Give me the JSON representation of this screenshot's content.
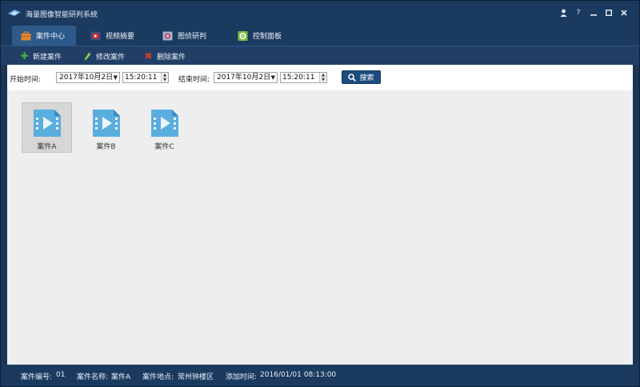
{
  "window": {
    "title": "海量图像智能研判系统",
    "controls": [
      "user-icon",
      "help-icon",
      "minimize-icon",
      "maximize-icon",
      "close-icon"
    ]
  },
  "tabs": [
    {
      "label": "案件中心",
      "icon": "briefcase-icon",
      "active": true
    },
    {
      "label": "视频摘要",
      "icon": "video-icon",
      "active": false
    },
    {
      "label": "图侦研判",
      "icon": "camera-icon",
      "active": false
    },
    {
      "label": "控制面板",
      "icon": "gear-icon",
      "active": false
    }
  ],
  "toolbar": {
    "new_label": "新建案件",
    "edit_label": "修改案件",
    "delete_label": "删除案件"
  },
  "filter": {
    "start_label": "开始时间:",
    "start_date": "2017年10月2日",
    "start_time": "15:20:11",
    "end_label": "结束时间:",
    "end_date": "2017年10月2日",
    "end_time": "15:20:11",
    "search_label": "搜索"
  },
  "cases": [
    {
      "label": "案件A",
      "selected": true
    },
    {
      "label": "案件B",
      "selected": false
    },
    {
      "label": "案件C",
      "selected": false
    }
  ],
  "status": {
    "case_no_label": "案件编号:",
    "case_no": "01",
    "case_name_label": "案件名称:",
    "case_name": "案件A",
    "case_place_label": "案件地点:",
    "case_place": "常州钟楼区",
    "added_label": "添加时间:",
    "added_time": "2016/01/01 08:13:00"
  },
  "colors": {
    "window_bg": "#1b3a60",
    "active_tab": "#2d5a8a",
    "content_bg": "#eeeeee",
    "new_icon": "#4caf3a",
    "delete_icon": "#d93a2b",
    "file_icon": "#5aaede"
  }
}
